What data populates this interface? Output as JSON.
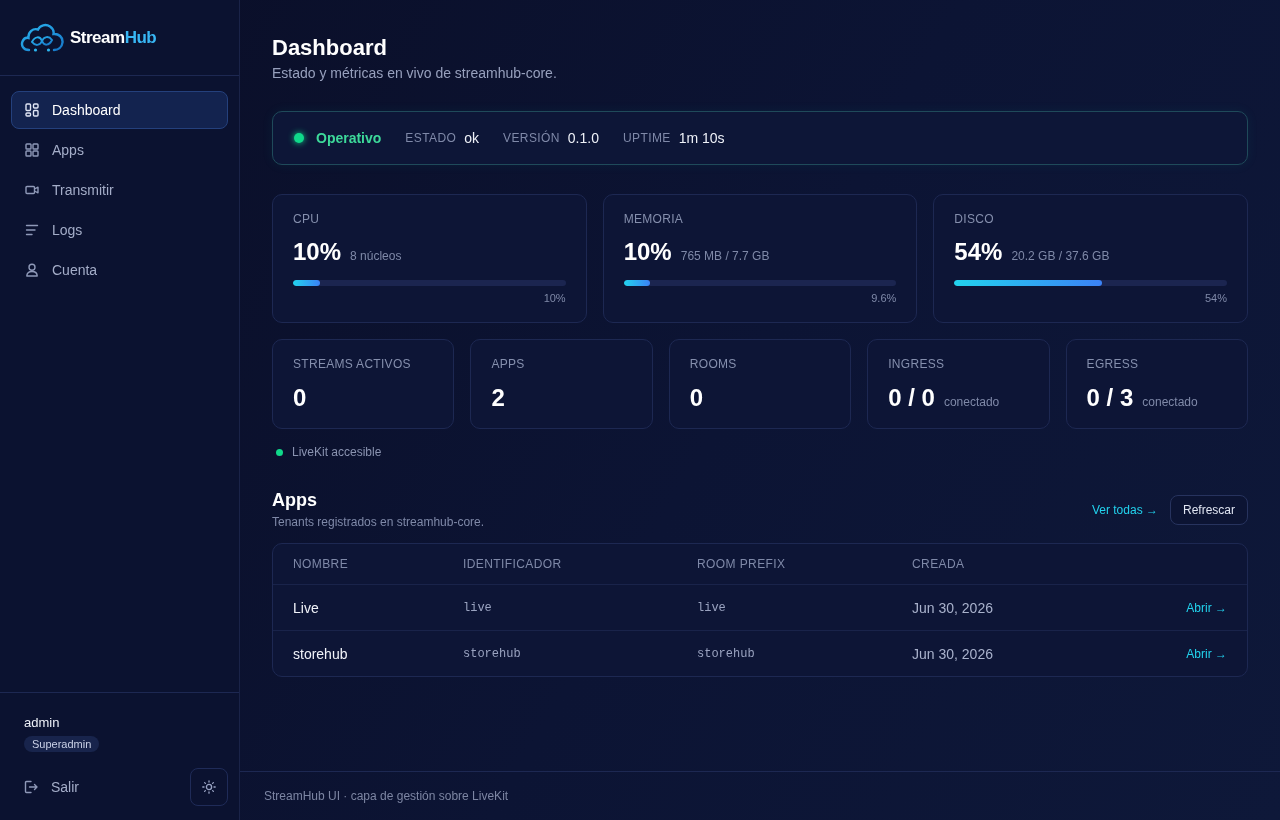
{
  "sidebar": {
    "brand": {
      "name": "Stream",
      "accent": "Hub"
    },
    "nav": [
      {
        "label": "Dashboard",
        "selected": true
      },
      {
        "label": "Apps",
        "selected": false
      },
      {
        "label": "Transmitir",
        "selected": false
      },
      {
        "label": "Logs",
        "selected": false
      },
      {
        "label": "Cuenta",
        "selected": false
      }
    ],
    "user": {
      "name": "admin",
      "role": "Superadmin"
    },
    "logout": "Salir"
  },
  "header": {
    "title": "Dashboard",
    "subtitle": "Estado y métricas en vivo de streamhub-core."
  },
  "status": {
    "label": "Operativo",
    "online": true,
    "fields": [
      {
        "label": "ESTADO",
        "value": "ok"
      },
      {
        "label": "VERSIÓN",
        "value": "0.1.0"
      },
      {
        "label": "UPTIME",
        "value": "1m 10s"
      }
    ]
  },
  "resources": [
    {
      "label": "CPU",
      "value": "10%",
      "detail": "8 núcleos",
      "level": 0.1,
      "reading": "10%"
    },
    {
      "label": "MEMORIA",
      "value": "10%",
      "detail": "765 MB / 7.7 GB",
      "level": 0.096,
      "reading": "9.6%"
    },
    {
      "label": "DISCO",
      "value": "54%",
      "detail": "20.2 GB / 37.6 GB",
      "level": 0.54,
      "reading": "54%"
    }
  ],
  "counters": [
    {
      "label": "STREAMS ACTIVOS",
      "value": "0"
    },
    {
      "label": "APPS",
      "value": "2"
    },
    {
      "label": "ROOMS",
      "value": "0"
    },
    {
      "label": "INGRESS",
      "value": "0 / 0",
      "detail": "conectado"
    },
    {
      "label": "EGRESS",
      "value": "0 / 3",
      "detail": "conectado"
    }
  ],
  "livekit": {
    "label": "LiveKit accesible",
    "online": true
  },
  "apps": {
    "title": "Apps",
    "subtitle": "Tenants registrados en streamhub-core.",
    "link": "Ver todas →",
    "button": "Refrescar",
    "columns": [
      "NOMBRE",
      "IDENTIFICADOR",
      "ROOM PREFIX",
      "CREADA"
    ],
    "rows": [
      {
        "name": "Live",
        "identifier": "live",
        "room_prefix": "live",
        "created": "Jun 30, 2026",
        "action": "Abrir →"
      },
      {
        "name": "storehub",
        "identifier": "storehub",
        "room_prefix": "storehub",
        "created": "Jun 30, 2026",
        "action": "Abrir →"
      }
    ]
  },
  "footer": {
    "text": "StreamHub UI · capa de gestión sobre LiveKit"
  }
}
